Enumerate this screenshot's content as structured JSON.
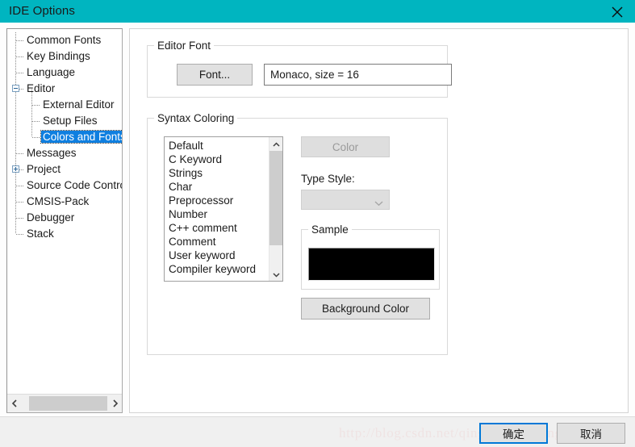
{
  "window": {
    "title": "IDE Options",
    "titlebar_color": "#00b5c0",
    "close_icon": "close-icon"
  },
  "tree": {
    "items": [
      {
        "label": "Common Fonts",
        "level": 0,
        "toggle": "none",
        "selected": false
      },
      {
        "label": "Key Bindings",
        "level": 0,
        "toggle": "none",
        "selected": false
      },
      {
        "label": "Language",
        "level": 0,
        "toggle": "none",
        "selected": false
      },
      {
        "label": "Editor",
        "level": 0,
        "toggle": "minus",
        "selected": false
      },
      {
        "label": "External Editor",
        "level": 1,
        "toggle": "none",
        "selected": false
      },
      {
        "label": "Setup Files",
        "level": 1,
        "toggle": "none",
        "selected": false
      },
      {
        "label": "Colors and Fonts",
        "level": 1,
        "toggle": "none",
        "selected": true
      },
      {
        "label": "Messages",
        "level": 0,
        "toggle": "none",
        "selected": false
      },
      {
        "label": "Project",
        "level": 0,
        "toggle": "plus",
        "selected": false
      },
      {
        "label": "Source Code Control",
        "level": 0,
        "toggle": "none",
        "selected": false
      },
      {
        "label": "CMSIS-Pack",
        "level": 0,
        "toggle": "none",
        "selected": false
      },
      {
        "label": "Debugger",
        "level": 0,
        "toggle": "none",
        "selected": false
      },
      {
        "label": "Stack",
        "level": 0,
        "toggle": "none",
        "selected": false
      }
    ],
    "selection_color": "#0f7fe0",
    "hscrollbar": {
      "left_arrow": "chevron-left-icon",
      "right_arrow": "chevron-right-icon"
    }
  },
  "editor_font": {
    "legend": "Editor Font",
    "font_button": "Font...",
    "font_value": "Monaco, size = 16"
  },
  "syntax_coloring": {
    "legend": "Syntax Coloring",
    "items": [
      "Default",
      "C Keyword",
      "Strings",
      "Char",
      "Preprocessor",
      "Number",
      "C++ comment",
      "Comment",
      "User keyword",
      "Compiler keyword"
    ],
    "scrollbar": {
      "up_arrow": "chevron-up-icon",
      "down_arrow": "chevron-down-icon"
    },
    "color_button": "Color",
    "color_button_enabled": false,
    "type_style_label": "Type Style:",
    "type_style_value": "",
    "type_style_enabled": false,
    "background_color_button": "Background Color",
    "sample": {
      "legend": "Sample",
      "swatch_color": "#000000"
    }
  },
  "footer": {
    "watermark": "http://blog.csdn.net/qinghuanmeiying",
    "ok_button": "确定",
    "cancel_button": "取消",
    "focus_color": "#0078d7"
  }
}
